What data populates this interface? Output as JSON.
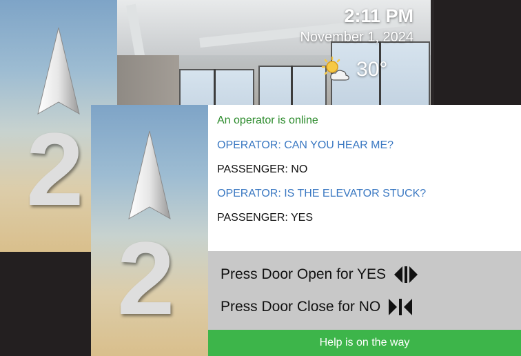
{
  "back_display": {
    "floor_number": "2",
    "direction": "up",
    "time": "2:11 PM",
    "date": "November 1, 2024",
    "weather": {
      "icon": "partly-sunny-icon",
      "temperature": "30°"
    }
  },
  "front_display": {
    "floor_number": "2",
    "direction": "up",
    "messages": [
      {
        "text": "An operator is online",
        "color": "#2a8a2a"
      },
      {
        "text": "OPERATOR: CAN YOU HEAR ME?",
        "color": "#3a78c2"
      },
      {
        "text": "PASSENGER: NO",
        "color": "#111111"
      },
      {
        "text": "OPERATOR: IS THE ELEVATOR STUCK?",
        "color": "#3a78c2"
      },
      {
        "text": "PASSENGER: YES",
        "color": "#111111"
      }
    ],
    "prompts": [
      {
        "text": "Press Door Open for YES",
        "icon": "door-open-icon"
      },
      {
        "text": "Press Door Close for NO",
        "icon": "door-close-icon"
      }
    ],
    "status": "Help is on the way",
    "colors": {
      "status_bar": "#3db54a",
      "prompt_area": "#c8c8c8"
    }
  }
}
